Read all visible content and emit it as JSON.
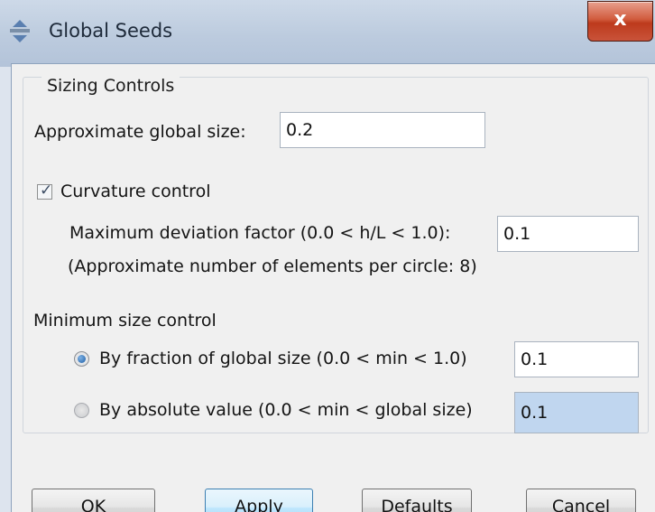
{
  "window": {
    "title": "Global Seeds",
    "close_label": "x"
  },
  "sizing": {
    "legend": "Sizing Controls",
    "approx_global_size_label": "Approximate global size:",
    "approx_global_size_value": "0.2",
    "curvature_label": "Curvature control",
    "curvature_checked": true,
    "max_deviation_label": "Maximum deviation factor (0.0 < h/L < 1.0):",
    "max_deviation_value": "0.1",
    "elements_per_circle_note": "(Approximate number of elements per circle: 8)",
    "min_size_heading": "Minimum size control",
    "fraction_label": "By fraction of global size  (0.0 < min < 1.0)",
    "fraction_value": "0.1",
    "fraction_selected": true,
    "absolute_label": "By absolute value  (0.0 < min < global size)",
    "absolute_value": "0.1",
    "absolute_selected": false
  },
  "buttons": {
    "ok": "OK",
    "apply": "Apply",
    "defaults": "Defaults",
    "cancel": "Cancel"
  },
  "icons": {
    "app": "abaqus-seed-icon",
    "close": "close-icon"
  }
}
